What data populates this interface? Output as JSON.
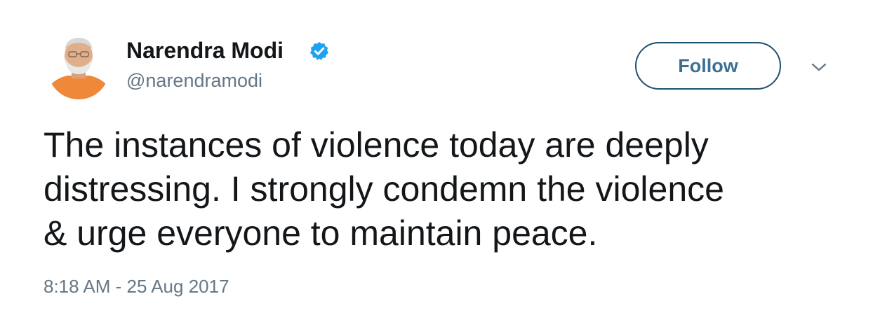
{
  "author": {
    "name": "Narendra Modi",
    "handle": "@narendramodi",
    "verified_icon": "verified-badge-icon",
    "avatar_icon": "profile-photo"
  },
  "actions": {
    "follow_label": "Follow",
    "more_icon": "chevron-down-icon"
  },
  "tweet": {
    "lines": [
      "The instances of violence today are deeply",
      "distressing. I strongly condemn the violence",
      "& urge everyone to maintain peace."
    ],
    "timestamp": "8:18 AM - 25 Aug 2017"
  },
  "colors": {
    "name": "#14171a",
    "secondary": "#657786",
    "verified": "#1da1f2",
    "follow_border": "#1d4f6e",
    "follow_text": "#3b6f94"
  }
}
